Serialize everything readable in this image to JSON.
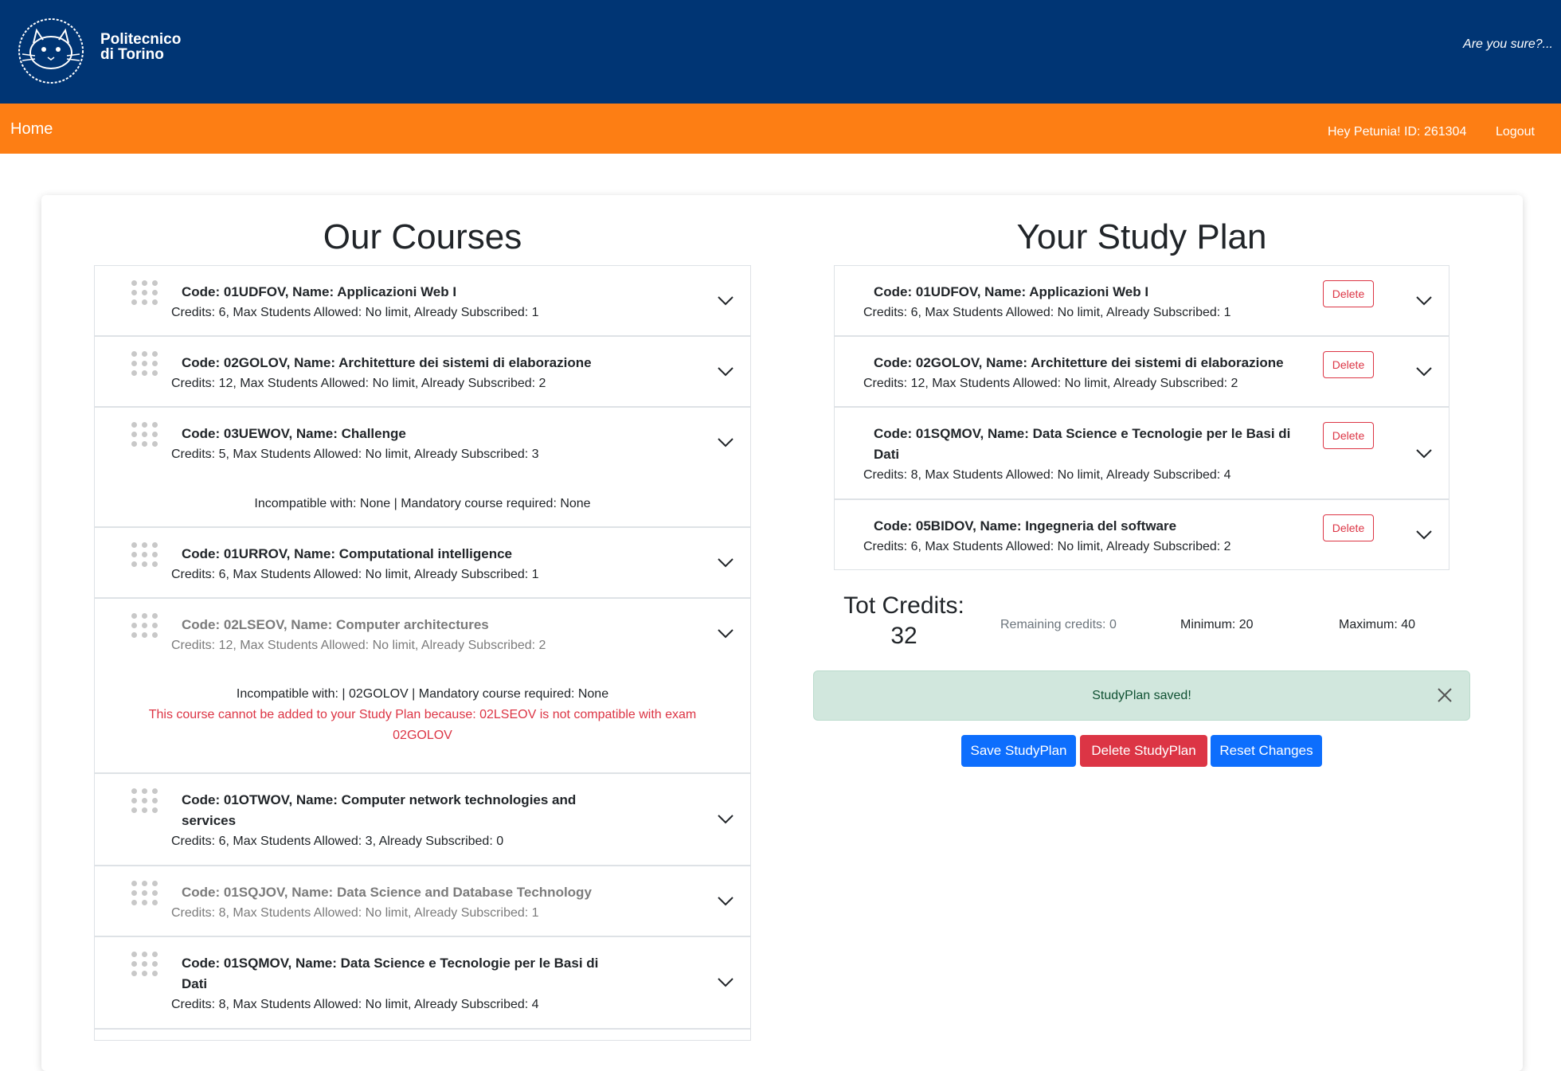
{
  "header": {
    "brand_line1": "Politecnico",
    "brand_line2": "di Torino",
    "tagline": "Are you sure?..."
  },
  "navbar": {
    "home": "Home",
    "user": "Hey Petunia! ID: 261304",
    "logout": "Logout"
  },
  "courses": {
    "title": "Our Courses",
    "items": [
      {
        "title": "Code: 01UDFOV, Name: Applicazioni Web I",
        "sub": "Credits: 6, Max Students Allowed: No limit, Already Subscribed: 1"
      },
      {
        "title": "Code: 02GOLOV, Name: Architetture dei sistemi di elaborazione",
        "sub": "Credits: 12, Max Students Allowed: No limit, Already Subscribed: 2"
      },
      {
        "title": "Code: 03UEWOV, Name: Challenge",
        "sub": "Credits: 5, Max Students Allowed: No limit, Already Subscribed: 3",
        "detail": "Incompatible with: None | Mandatory course required: None"
      },
      {
        "title": "Code: 01URROV, Name: Computational intelligence",
        "sub": "Credits: 6, Max Students Allowed: No limit, Already Subscribed: 1"
      },
      {
        "title": "Code: 02LSEOV, Name: Computer architectures",
        "sub": "Credits: 12, Max Students Allowed: No limit, Already Subscribed: 2",
        "detail": "Incompatible with: | 02GOLOV | Mandatory course required: None",
        "error_line1": "This course cannot be added to your Study Plan because: 02LSEOV is not compatible with exam",
        "error_line2": "02GOLOV"
      },
      {
        "title_line1": "Code: 01OTWOV, Name: Computer network technologies and",
        "title_line2": "services",
        "sub": "Credits: 6, Max Students Allowed: 3, Already Subscribed: 0"
      },
      {
        "title": "Code: 01SQJOV, Name: Data Science and Database Technology",
        "sub": "Credits: 8, Max Students Allowed: No limit, Already Subscribed: 1"
      },
      {
        "title_line1": "Code: 01SQMOV, Name: Data Science e Tecnologie per le Basi di",
        "title_line2": "Dati",
        "sub": "Credits: 8, Max Students Allowed: No limit, Already Subscribed: 4"
      }
    ]
  },
  "plan": {
    "title": "Your Study Plan",
    "delete_label": "Delete",
    "items": [
      {
        "title": "Code: 01UDFOV, Name: Applicazioni Web I",
        "sub": "Credits: 6, Max Students Allowed: No limit, Already Subscribed: 1"
      },
      {
        "title": "Code: 02GOLOV, Name: Architetture dei sistemi di elaborazione",
        "sub": "Credits: 12, Max Students Allowed: No limit, Already Subscribed: 2"
      },
      {
        "title_line1": "Code: 01SQMOV, Name: Data Science e Tecnologie per le Basi di",
        "title_line2": "Dati",
        "sub": "Credits: 8, Max Students Allowed: No limit, Already Subscribed: 4"
      },
      {
        "title": "Code: 05BIDOV, Name: Ingegneria del software",
        "sub": "Credits: 6, Max Students Allowed: No limit, Already Subscribed: 2"
      }
    ],
    "tot_label": "Tot Credits:",
    "tot_value": "32",
    "remaining": "Remaining credits: 0",
    "minimum": "Minimum: 20",
    "maximum": "Maximum: 40",
    "alert": "StudyPlan saved!",
    "save_label": "Save StudyPlan",
    "delete_plan_label": "Delete StudyPlan",
    "reset_label": "Reset Changes"
  },
  "colors": {
    "header_blue": "#003574",
    "nav_orange": "#fd7e14",
    "primary": "#0d6efd",
    "danger": "#dc3545",
    "alert_bg": "#d1e7dd"
  }
}
